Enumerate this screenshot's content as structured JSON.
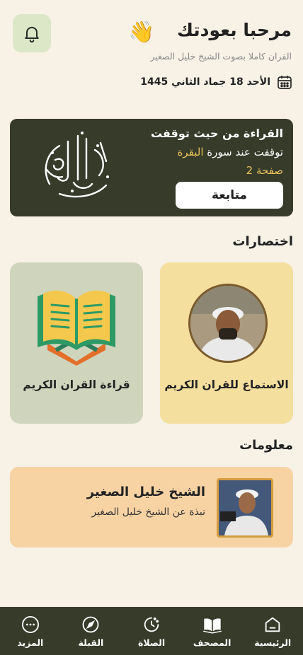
{
  "header": {
    "welcome": "مرحبا بعودتك",
    "subtitle": "القران كاملا بصوت الشيخ خليل الصغير",
    "date": "الأحد 18 جماد الثاني 1445"
  },
  "continue_card": {
    "title": "القراءة من حيث توقفت",
    "stopped_prefix": "توقفت عند سورة",
    "surah": "البقرة",
    "page": "صفحة 2",
    "button": "متابعة"
  },
  "shortcuts": {
    "title": "اختصارات",
    "items": [
      {
        "label": "الاستماع للقران الكريم"
      },
      {
        "label": "قراءة القران الكريم"
      }
    ]
  },
  "info": {
    "title": "معلومات",
    "name": "الشيخ خليل الصغير",
    "description": "نبذة عن الشيخ خليل الصغير"
  },
  "bottom_nav": {
    "items": [
      {
        "label": "الرئيسية",
        "icon": "home-icon"
      },
      {
        "label": "المصحف",
        "icon": "mushaf-icon"
      },
      {
        "label": "الصلاة",
        "icon": "prayer-clock-icon"
      },
      {
        "label": "القبلة",
        "icon": "compass-icon"
      },
      {
        "label": "المزيد",
        "icon": "more-icon"
      }
    ]
  },
  "colors": {
    "background": "#f7f1e6",
    "dark_green": "#363b2a",
    "gold": "#e8c35a",
    "bell_bg": "#dbe7c6",
    "listen_card": "#f5df9f",
    "read_card": "#cfd5bd",
    "info_card": "#f7d3a4"
  }
}
